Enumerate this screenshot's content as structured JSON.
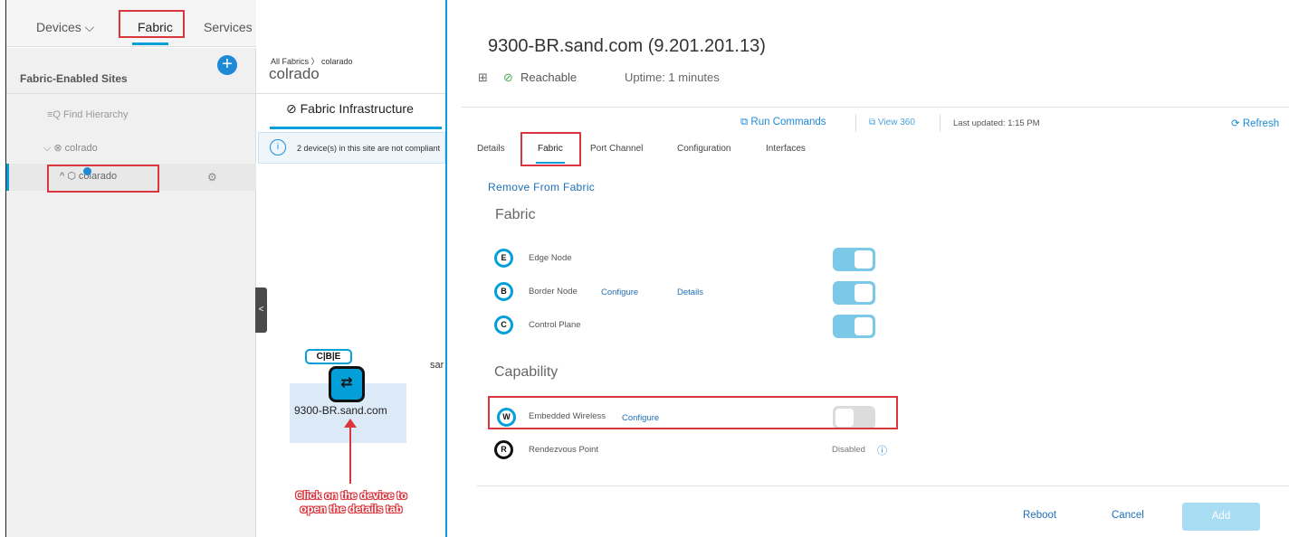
{
  "nav": {
    "devices": "Devices ⌵",
    "fabric": "Fabric",
    "services": "Services"
  },
  "sidebar": {
    "title": "Fabric-Enabled Sites",
    "add_icon": "+",
    "find": "≡Q  Find Hierarchy",
    "parent_site": "⌵ ⊗ colrado",
    "child_site": "^ ⬡ colarado",
    "gear_icon": "⚙"
  },
  "middle": {
    "breadcrumb": "All Fabrics 〉 colarado",
    "title": "colrado",
    "tab": "⊘ Fabric Infrastructure",
    "info_text": "2 device(s) in this site are not compliant",
    "info_icon": "i",
    "collapse_icon": "<",
    "device_badge": "C|B|E",
    "device_name": "9300-BR.sand.com",
    "cut_text": "sar",
    "callout": "Click on the device to open the details tab"
  },
  "detail": {
    "title": "9300-BR.sand.com (9.201.201.13)",
    "device_icon": "⊞",
    "status_icon": "⊘",
    "status": "Reachable",
    "uptime": "Uptime: 1 minutes",
    "run_commands": "⧉ Run Commands",
    "view360": "⧉ View 360",
    "last_updated": "Last updated: 1:15 PM",
    "refresh": "⟳ Refresh",
    "tabs": [
      "Details",
      "Fabric",
      "Port Channel",
      "Configuration",
      "Interfaces"
    ],
    "remove_link": "Remove From Fabric",
    "fabric_section": "Fabric",
    "fabric_rows": [
      {
        "badge": "E",
        "label": "Edge Node",
        "on": true
      },
      {
        "badge": "B",
        "label": "Border Node",
        "configure": "Configure",
        "details": "Details",
        "on": true
      },
      {
        "badge": "C",
        "label": "Control Plane",
        "on": true
      }
    ],
    "capability_section": "Capability",
    "capability_rows": [
      {
        "badge": "W",
        "label": "Embedded Wireless",
        "configure": "Configure",
        "on": false
      },
      {
        "badge": "R",
        "label": "Rendezvous Point",
        "status": "Disabled",
        "info_icon": "ⓘ"
      }
    ],
    "buttons": {
      "reboot": "Reboot",
      "cancel": "Cancel",
      "add": "Add"
    }
  },
  "colors": {
    "accent": "#049fd9",
    "annotation": "#d9363e",
    "toggle_on": "#7cc8e9",
    "toggle_off": "#dcdcdc"
  }
}
